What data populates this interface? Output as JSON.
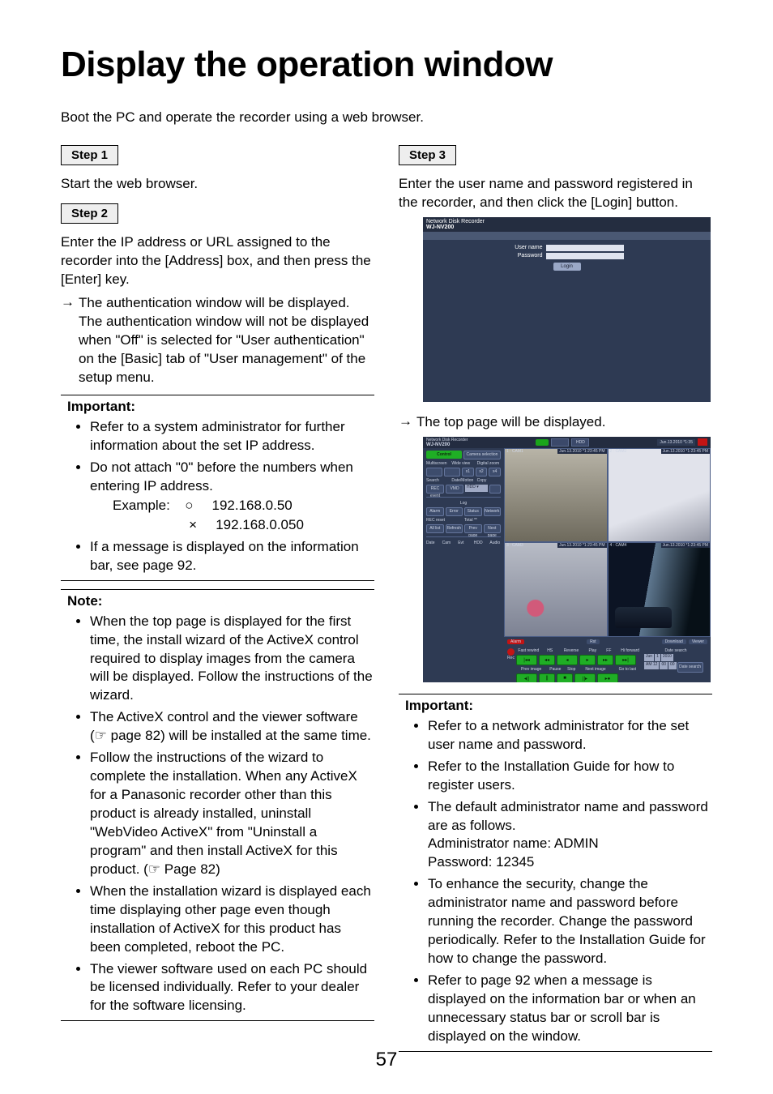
{
  "title": "Display the operation window",
  "intro": "Boot the PC and operate the recorder using a web browser.",
  "left": {
    "step1_label": "Step 1",
    "step1_text": "Start the web browser.",
    "step2_label": "Step 2",
    "step2_text": "Enter the IP address or URL assigned to the recorder into the [Address] box, and then press the [Enter] key.",
    "step2_arrow": "The authentication window will be displayed. The authentication window will not be displayed when \"Off\" is selected for \"User authentication\" on the [Basic] tab of \"User management\" of the setup menu.",
    "important_label": "Important:",
    "important": [
      "Refer to a system administrator for further information about the set IP address.",
      "Do not attach \"0\" before the numbers when entering IP address."
    ],
    "example_label": "Example:",
    "example_ok": "192.168.0.50",
    "example_ng": "192.168.0.050",
    "important_after": "If a message is displayed on the information bar, see page 92.",
    "note_label": "Note:",
    "notes": [
      "When the top page is displayed for the first time, the install wizard of the ActiveX control required to display images from the camera will be displayed. Follow the instructions of the wizard.",
      "The ActiveX control and the viewer software (☞ page 82) will be installed at the same time.",
      "Follow the instructions of the wizard to complete the installation. When any ActiveX for a Panasonic recorder other than this product is already installed, uninstall \"WebVideo ActiveX\" from \"Uninstall a program\" and then install ActiveX for this product. (☞ Page 82)",
      "When the installation wizard is displayed each time displaying other page even though installation of ActiveX for this product has been completed, reboot the PC.",
      "The viewer software used on each PC should be licensed individually. Refer to your dealer for the software licensing."
    ]
  },
  "right": {
    "step3_label": "Step 3",
    "step3_text": "Enter the user name and password registered in the recorder, and then click the [Login] button.",
    "login_fig": {
      "product": "Network Disk Recorder",
      "model": "WJ-NV200",
      "user_label": "User name",
      "pass_label": "Password",
      "login_btn": "Login"
    },
    "after_login_arrow": "The top page will be displayed.",
    "main_fig": {
      "product": "Network Disk Recorder",
      "model": "WJ-NV200",
      "hdd": "HDD",
      "clock": "Jun.13.2010  *1:35",
      "cam_ts": "Jun.13.2010 *1:23:45 PM",
      "cams": [
        "1 : CAM1",
        "2 : CAM2",
        "3 : CAM3",
        "4 : CAM4"
      ],
      "control": "Control",
      "cam_sel": "Camera selection",
      "multiscreen": "Multiscreen",
      "wide_view": "Wide view",
      "digital_zoom": "Digital zoom",
      "x1": "x1",
      "x2": "x2",
      "x4": "x4",
      "search": "Search",
      "date_motion": "Date/Motion",
      "copy": "Copy",
      "rec_event": "REC event",
      "vmd": "VMD",
      "hdd_sel": "HDD",
      "log": "Log",
      "alarm": "Alarm",
      "error": "Error",
      "status": "Status",
      "network": "Network",
      "rec_reset": "REC reset",
      "total": "Total **",
      "all_list": "All list",
      "refresh": "Refresh",
      "prev_page": "Prev page",
      "next_page": "Next page",
      "cols": [
        "Date",
        "Cam",
        "Evt",
        "HDD",
        "Audio"
      ],
      "status_alarm": "Alarm",
      "status_rst": "Rst",
      "download": "Download",
      "viewer": "Viewer",
      "rec": "Rec",
      "playback": {
        "fast_rewind": "Fast rewind",
        "hs": "HS",
        "reverse": "Reverse",
        "play": "Play",
        "ff": "FF",
        "hi_forward": "Hi forward",
        "prev_image": "Prev image",
        "pause": "Pause",
        "stop": "Stop",
        "next_image": "Next image",
        "goto_last": "Go to last",
        "date_search": "Date search",
        "date_m": "Jun",
        "date_d": "1",
        "date_y": "2010",
        "time_a": "AM 12",
        "time_h": "00",
        "time_m": "00",
        "ds_btn": "Date search"
      }
    },
    "important_label": "Important:",
    "important": [
      "Refer to a network administrator for the set user name and password.",
      "Refer to the Installation Guide for how to register users.",
      "The default administrator name and password are as follows."
    ],
    "admin_name_line": "Administrator name: ADMIN",
    "admin_pass_line": "Password: 12345",
    "important2": [
      "To enhance the security, change the administrator name and password before running the recorder. Change the password periodically. Refer to the Installation Guide for how to change the password.",
      "Refer to page 92 when a message is displayed on the information bar or when an unnecessary status bar or scroll bar is displayed on the window."
    ]
  },
  "page_number": "57"
}
